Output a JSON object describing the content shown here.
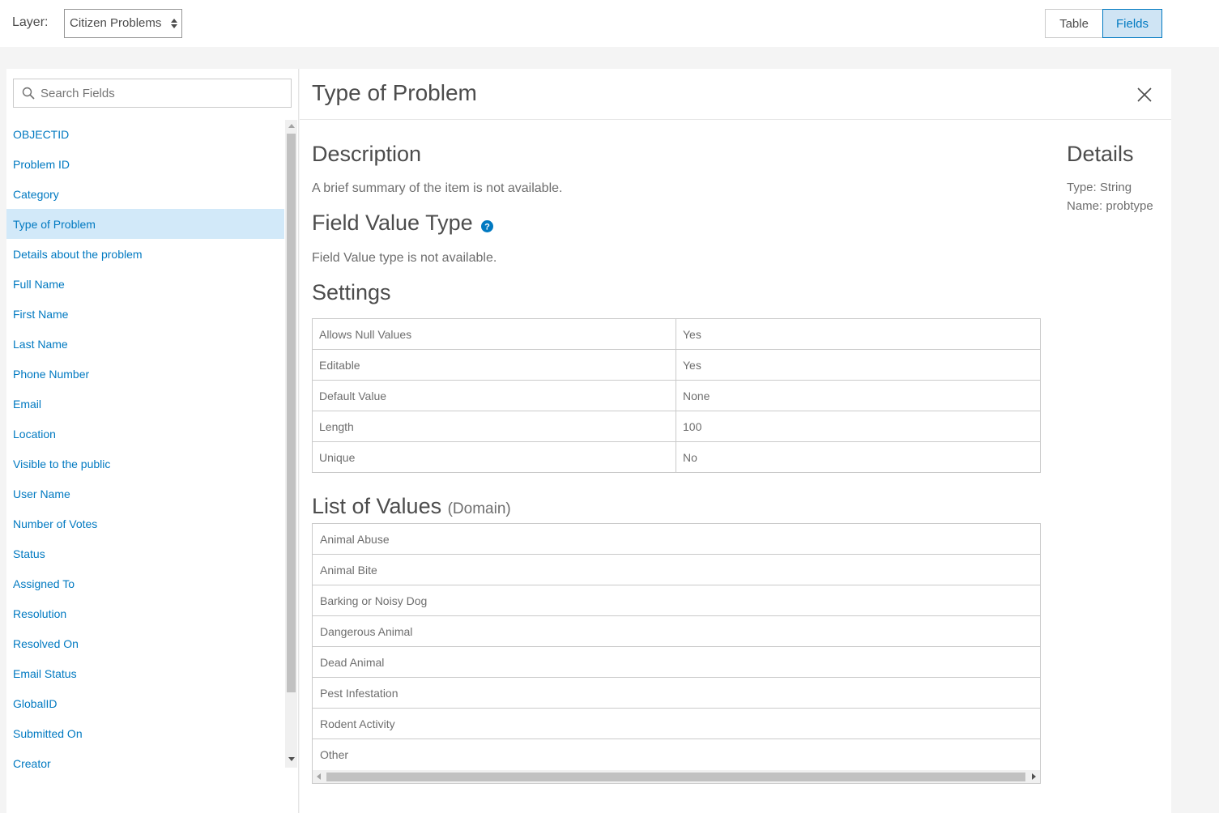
{
  "topbar": {
    "layer_label": "Layer:",
    "layer_selected": "Citizen Problems",
    "view_tabs": [
      {
        "label": "Table",
        "active": false
      },
      {
        "label": "Fields",
        "active": true
      }
    ]
  },
  "sidebar": {
    "search_placeholder": "Search Fields",
    "fields": [
      "OBJECTID",
      "Problem ID",
      "Category",
      "Type of Problem",
      "Details about the problem",
      "Full Name",
      "First Name",
      "Last Name",
      "Phone Number",
      "Email",
      "Location",
      "Visible to the public",
      "User Name",
      "Number of Votes",
      "Status",
      "Assigned To",
      "Resolution",
      "Resolved On",
      "Email Status",
      "GlobalID",
      "Submitted On",
      "Creator"
    ],
    "selected_field": "Type of Problem"
  },
  "panel": {
    "title": "Type of Problem",
    "description_heading": "Description",
    "description_text": "A brief summary of the item is not available.",
    "field_value_type_heading": "Field Value Type",
    "field_value_type_text": "Field Value type is not available.",
    "settings_heading": "Settings",
    "settings": [
      {
        "name": "Allows Null Values",
        "value": "Yes"
      },
      {
        "name": "Editable",
        "value": "Yes"
      },
      {
        "name": "Default Value",
        "value": "None"
      },
      {
        "name": "Length",
        "value": "100"
      },
      {
        "name": "Unique",
        "value": "No"
      }
    ],
    "domain_heading": "List of Values",
    "domain_subheading": "(Domain)",
    "domain_values": [
      "Animal Abuse",
      "Animal Bite",
      "Barking or Noisy Dog",
      "Dangerous Animal",
      "Dead Animal",
      "Pest Infestation",
      "Rodent Activity",
      "Other"
    ],
    "details_heading": "Details",
    "details_type": "Type: String",
    "details_name": "Name: probtype"
  },
  "colors": {
    "accent": "#0079c1",
    "selected_bg": "#d2e9f9",
    "active_tab_bg": "#cfe4f4"
  }
}
